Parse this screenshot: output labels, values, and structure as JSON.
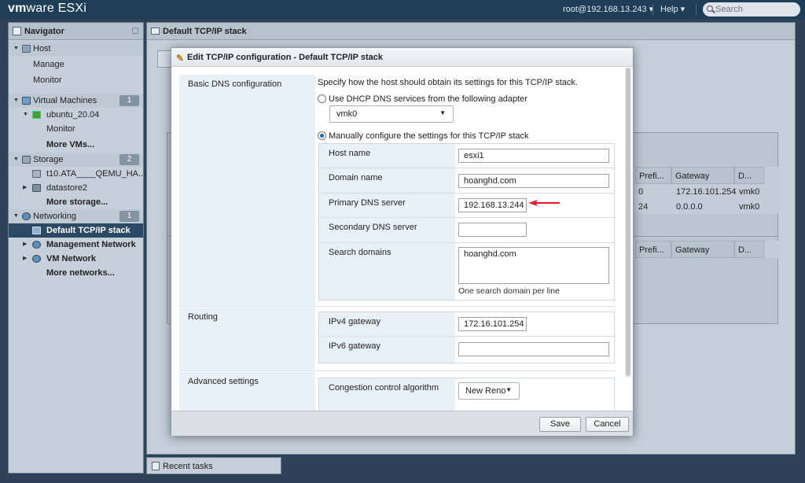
{
  "app": {
    "logo_brand": "vm",
    "logo_text": "ware",
    "logo_product": "ESXi",
    "user": "root@192.168.13.243 ▾",
    "help": "Help ▾",
    "search_placeholder": "Search"
  },
  "navigator": {
    "title": "Navigator",
    "items": [
      {
        "label": "Host"
      },
      {
        "label": "Manage"
      },
      {
        "label": "Monitor"
      },
      {
        "label": "Virtual Machines",
        "badge": "1"
      },
      {
        "label": "ubuntu_20.04"
      },
      {
        "label": "Monitor"
      },
      {
        "label": "More VMs..."
      },
      {
        "label": "Storage",
        "badge": "2"
      },
      {
        "label": "t10.ATA____QEMU_HA..."
      },
      {
        "label": "datastore2"
      },
      {
        "label": "More storage..."
      },
      {
        "label": "Networking",
        "badge": "1"
      },
      {
        "label": "Default TCP/IP stack"
      },
      {
        "label": "Management Network"
      },
      {
        "label": "VM Network"
      },
      {
        "label": "More networks..."
      }
    ]
  },
  "main": {
    "title": "Default TCP/IP stack",
    "table1": {
      "headers": [
        "Prefi...",
        "Gateway",
        "D..."
      ],
      "rows": [
        [
          "0",
          "172.16.101.254",
          "vmk0"
        ],
        [
          "24",
          "0.0.0.0",
          "vmk0"
        ]
      ]
    },
    "table2": {
      "headers": [
        "Prefi...",
        "Gateway",
        "D..."
      ]
    }
  },
  "recent_tasks": "Recent tasks",
  "dialog": {
    "title": "Edit TCP/IP configuration - Default TCP/IP stack",
    "dns": {
      "label": "Basic DNS configuration",
      "description": "Specify how the host should obtain its settings for this TCP/IP stack.",
      "option_dhcp": "Use DHCP DNS services from the following adapter",
      "adapter": "vmk0",
      "option_manual": "Manually configure the settings for this TCP/IP stack",
      "host_name_label": "Host name",
      "host_name": "esxi1",
      "domain_name_label": "Domain name",
      "domain_name": "hoanghd.com",
      "primary_dns_label": "Primary DNS server",
      "primary_dns": "192.168.13.244",
      "secondary_dns_label": "Secondary DNS server",
      "secondary_dns": "",
      "search_domains_label": "Search domains",
      "search_domains": "hoanghd.com",
      "search_hint": "One search domain per line"
    },
    "routing": {
      "label": "Routing",
      "ipv4_label": "IPv4 gateway",
      "ipv4": "172.16.101.254",
      "ipv6_label": "IPv6 gateway",
      "ipv6": ""
    },
    "advanced": {
      "label": "Advanced settings",
      "congestion_label": "Congestion control algorithm",
      "congestion": "New Reno"
    },
    "save": "Save",
    "cancel": "Cancel"
  },
  "colors": {
    "accent": "#1f64c8",
    "arrow": "#e8192c",
    "selected_nav": "#2c4a66"
  }
}
